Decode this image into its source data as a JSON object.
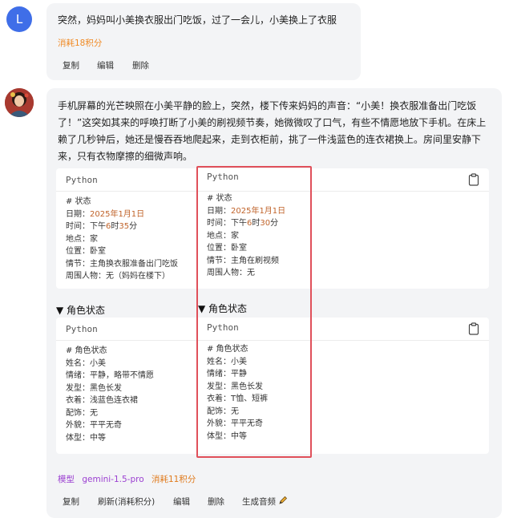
{
  "user_message": {
    "avatar_letter": "L",
    "text": "突然，妈妈叫小美换衣服出门吃饭，过了一会儿，小美换上了衣服",
    "cost": "消耗18积分",
    "actions": {
      "copy": "复制",
      "edit": "编辑",
      "delete": "删除"
    }
  },
  "ai_message": {
    "paragraph": "手机屏幕的光芒映照在小美平静的脸上，突然，楼下传来妈妈的声音：“小美！换衣服准备出门吃饭了！”这突如其来的呼唤打断了小美的刷视频节奏，她微微叹了口气，有些不情愿地放下手机。在床上赖了几秒钟后，她还是慢吞吞地爬起来，走到衣柜前，挑了一件浅蓝色的连衣裙换上。房间里安静下来，只有衣物摩擦的细微声响。",
    "status_block": {
      "lang": "Python",
      "lang_overlay": "Python",
      "lines": [
        "# 状态",
        "日期：",
        "时间：下午",
        "地点：家",
        "位置：卧室",
        "情节：主角换衣服准备出门吃饭",
        "周围人物：无（妈妈在楼下）"
      ],
      "date_value": "2025年1月1日",
      "time_num": "6",
      "time_text1": "时",
      "time_num2": "35",
      "time_text2": "分",
      "overlay_lines": [
        "# 状态",
        "日期：",
        "时间：下午",
        "地点：家",
        "位置：卧室",
        "情节：主角在刷视频",
        "周围人物：无"
      ],
      "overlay_time_num2": "30"
    },
    "character_section_title": "▼ 角色状态",
    "character_section_title_overlay": "▼ 角色状态",
    "character_block": {
      "lang": "Python",
      "lang_overlay": "Python",
      "lines": [
        "# 角色状态",
        "姓名：小美",
        "情绪：平静，略带不情愿",
        "发型：黑色长发",
        "衣着：浅蓝色连衣裙",
        "配饰：无",
        "外貌：平平无奇",
        "体型：中等"
      ],
      "overlay_lines": [
        "# 角色状态",
        "姓名：小美",
        "情绪：平静",
        "发型：黑色长发",
        "衣着：T恤、短裤",
        "配饰：无",
        "外貌：平平无奇",
        "体型：中等"
      ]
    },
    "model_label": "模型",
    "model_name": "gemini-1.5-pro",
    "cost": "消耗11积分",
    "actions": {
      "copy": "复制",
      "refresh": "刷新(消耗积分)",
      "edit": "编辑",
      "delete": "删除",
      "audio": "生成音频"
    }
  },
  "colors": {
    "accent_orange": "#f08a24",
    "model_purple": "#9b3fd1",
    "highlight_red": "#e0505a",
    "user_avatar": "#3f6ee8"
  }
}
